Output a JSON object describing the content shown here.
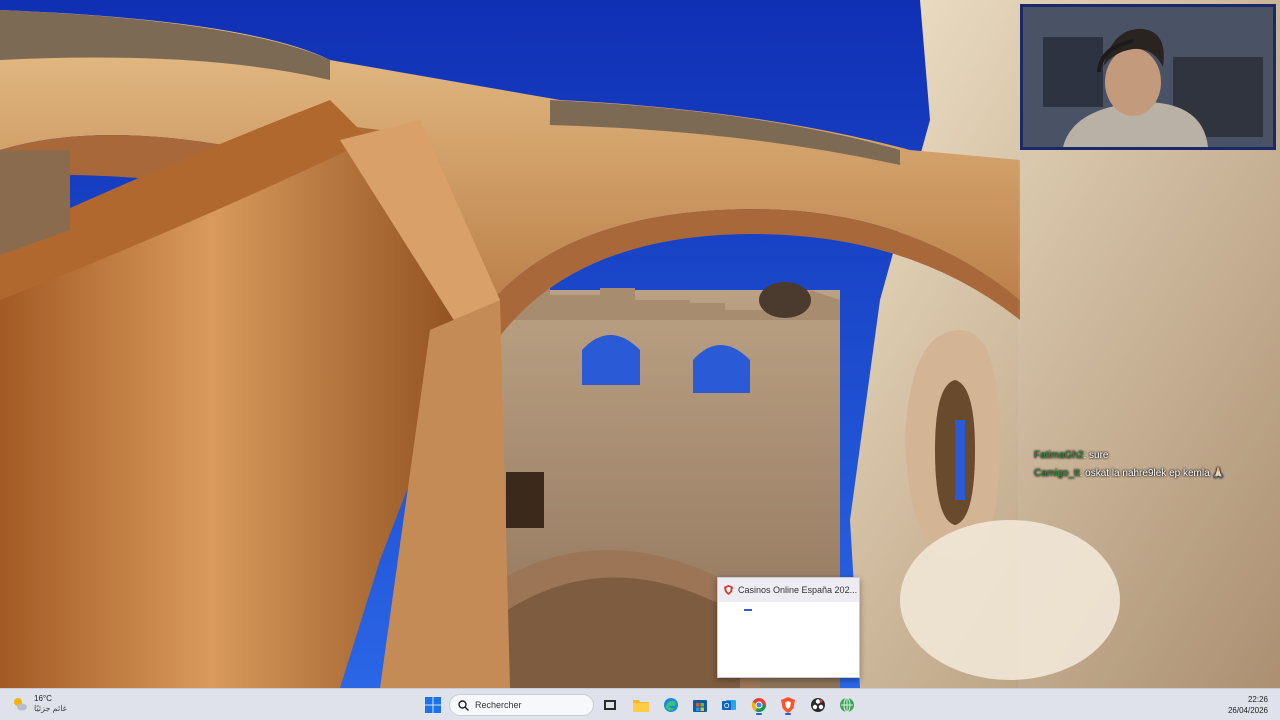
{
  "chat": {
    "messages": [
      {
        "user": "FatimaGh2",
        "text": ": sure"
      },
      {
        "user": "Camigo_tt",
        "text": ": oskat la nahre9lek ep kemla 🙏🏻"
      }
    ]
  },
  "notification": {
    "title": "Casinos Online España 202..."
  },
  "taskbar": {
    "weather": {
      "temperature": "16°C",
      "description": "غائم جزئيًا"
    },
    "search": {
      "placeholder": "Rechercher"
    },
    "clock": {
      "time": "22:26",
      "date": "26/04/2026"
    },
    "apps": [
      {
        "name": "start-button",
        "icon": "windows-logo-icon"
      },
      {
        "name": "task-view-button",
        "icon": "task-view-icon"
      },
      {
        "name": "file-explorer-button",
        "icon": "folder-icon"
      },
      {
        "name": "edge-button",
        "icon": "edge-icon"
      },
      {
        "name": "store-button",
        "icon": "store-icon"
      },
      {
        "name": "outlook-button",
        "icon": "outlook-icon"
      },
      {
        "name": "chrome-button",
        "icon": "chrome-icon"
      },
      {
        "name": "brave-button",
        "icon": "brave-lion-icon"
      },
      {
        "name": "obs-button",
        "icon": "obs-icon"
      },
      {
        "name": "network-app-button",
        "icon": "globe-icon"
      }
    ]
  },
  "colors": {
    "sky": "#1845c4",
    "stone": "#c98a4c",
    "taskbar": "#dfe2ea",
    "chat_user": "#2e8b3a",
    "accent": "#2a60d9"
  }
}
